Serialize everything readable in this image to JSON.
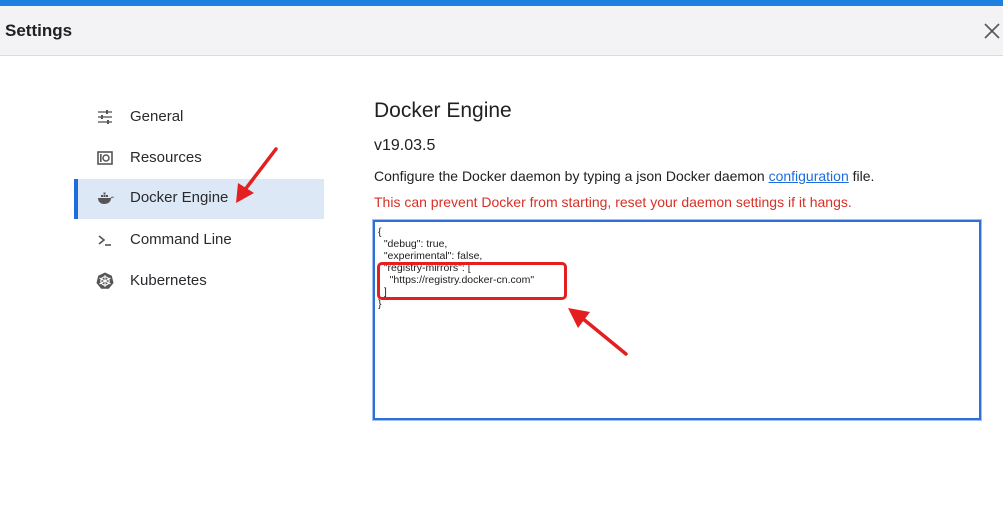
{
  "window": {
    "title": "Settings",
    "accent_color": "#1d7fe0"
  },
  "sidebar": {
    "items": [
      {
        "label": "General",
        "icon": "sliders-icon",
        "active": false
      },
      {
        "label": "Resources",
        "icon": "resources-icon",
        "active": false
      },
      {
        "label": "Docker Engine",
        "icon": "whale-icon",
        "active": true
      },
      {
        "label": "Command Line",
        "icon": "terminal-icon",
        "active": false
      },
      {
        "label": "Kubernetes",
        "icon": "helm-wheel-icon",
        "active": false
      }
    ]
  },
  "main": {
    "title": "Docker Engine",
    "version": "v19.03.5",
    "description_prefix": "Configure the Docker daemon by typing a json Docker daemon ",
    "description_link": "configuration",
    "description_suffix": " file.",
    "warning": "This can prevent Docker from starting, reset your daemon settings if it hangs.",
    "warning_color": "#d83026",
    "editor_value": "{\n  \"debug\": true,\n  \"experimental\": false,\n  \"registry-mirrors\": [\n    \"https://registry.docker-cn.com\"\n  ]\n}"
  },
  "annotations": {
    "color": "#e41f1f"
  }
}
